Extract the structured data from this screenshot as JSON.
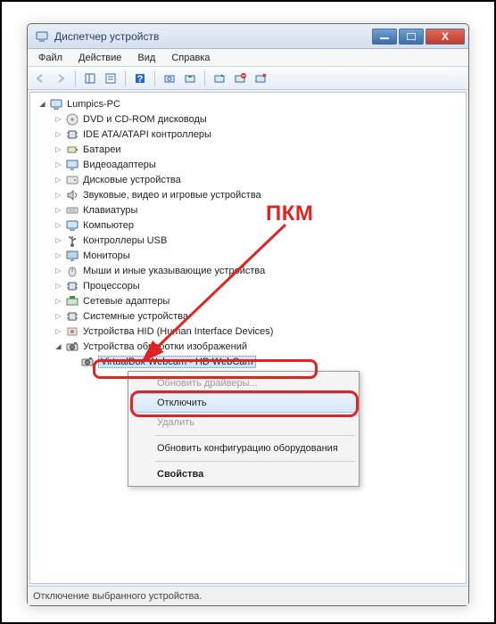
{
  "window": {
    "title": "Диспетчер устройств",
    "min_label": "—",
    "max_label": "□",
    "close_label": "X"
  },
  "menu": {
    "file": "Файл",
    "action": "Действие",
    "view": "Вид",
    "help": "Справка"
  },
  "tree": {
    "root": "Lumpics-PC",
    "items": [
      "DVD и CD-ROM дисководы",
      "IDE ATA/ATAPI контроллеры",
      "Батареи",
      "Видеоадаптеры",
      "Дисковые устройства",
      "Звуковые, видео и игровые устройства",
      "Клавиатуры",
      "Компьютер",
      "Контроллеры USB",
      "Мониторы",
      "Мыши и иные указывающие устройства",
      "Процессоры",
      "Сетевые адаптеры",
      "Системные устройства",
      "Устройства HID (Human Interface Devices)",
      "Устройства обработки изображений"
    ],
    "selected_device": "VirtualBox Webcam - HD WebCam"
  },
  "context_menu": {
    "update_drivers": "Обновить драйверы...",
    "disable": "Отключить",
    "delete": "Удалить",
    "scan": "Обновить конфигурацию оборудования",
    "properties": "Свойства"
  },
  "status": "Отключение выбранного устройства.",
  "annotation": "ПКМ",
  "icons": {
    "computer": "computer",
    "dvd": "disc",
    "ide": "chip",
    "battery": "battery",
    "video": "display",
    "disk": "drive",
    "sound": "speaker",
    "keyboard": "keyboard",
    "pc": "computer",
    "usb": "usb",
    "monitor": "monitor",
    "mouse": "mouse",
    "cpu": "chip",
    "network": "nic",
    "system": "chip",
    "hid": "hid",
    "imaging": "camera",
    "webcam": "camera"
  }
}
